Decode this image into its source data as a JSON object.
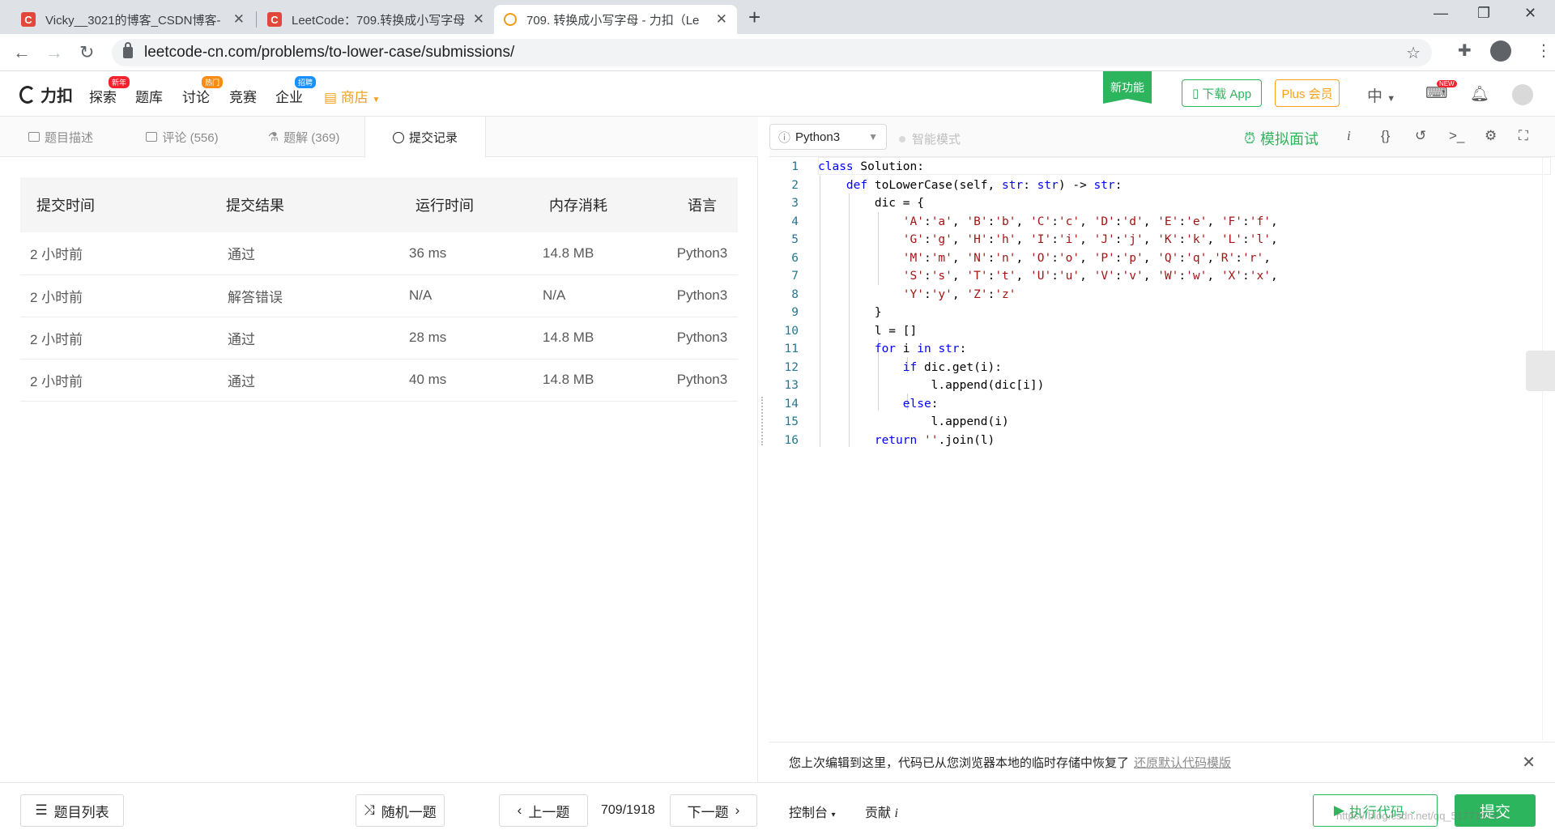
{
  "browser": {
    "tabs": [
      {
        "title": "Vicky__3021的博客_CSDN博客-",
        "favicon": "C"
      },
      {
        "title": "LeetCode：709.转换成小写字母",
        "favicon": "C"
      },
      {
        "title": "709. 转换成小写字母 - 力扣（Le",
        "favicon": "C"
      }
    ],
    "url": "leetcode-cn.com/problems/to-lower-case/submissions/"
  },
  "header": {
    "logo": "力扣",
    "nav": [
      {
        "label": "探索",
        "badge": "新年"
      },
      {
        "label": "题库",
        "badge": ""
      },
      {
        "label": "讨论",
        "badge": "热门"
      },
      {
        "label": "竞赛",
        "badge": ""
      },
      {
        "label": "企业",
        "badge": "招聘"
      },
      {
        "label": "商店",
        "badge": ""
      }
    ],
    "new_feature": "新功能",
    "download_app": "下载 App",
    "plus": "Plus 会员",
    "lang": "中",
    "new_tag": "NEW"
  },
  "left_tabs": [
    {
      "label": "题目描述"
    },
    {
      "label": "评论 (556)"
    },
    {
      "label": "题解 (369)"
    },
    {
      "label": "提交记录"
    }
  ],
  "submissions": {
    "headers": [
      "提交时间",
      "提交结果",
      "运行时间",
      "内存消耗",
      "语言"
    ],
    "rows": [
      {
        "time": "2 小时前",
        "result": "通过",
        "runtime": "36 ms",
        "memory": "14.8 MB",
        "lang": "Python3",
        "status": "accepted"
      },
      {
        "time": "2 小时前",
        "result": "解答错误",
        "runtime": "N/A",
        "memory": "N/A",
        "lang": "Python3",
        "status": "wrong"
      },
      {
        "time": "2 小时前",
        "result": "通过",
        "runtime": "28 ms",
        "memory": "14.8 MB",
        "lang": "Python3",
        "status": "accepted"
      },
      {
        "time": "2 小时前",
        "result": "通过",
        "runtime": "40 ms",
        "memory": "14.8 MB",
        "lang": "Python3",
        "status": "accepted"
      }
    ]
  },
  "editor": {
    "language": "Python3",
    "smart_mode": "智能模式",
    "mock_interview": "模拟面试",
    "code": [
      "class Solution:",
      "    def toLowerCase(self, str: str) -> str:",
      "        dic = {",
      "            'A':'a', 'B':'b', 'C':'c', 'D':'d', 'E':'e', 'F':'f',",
      "            'G':'g', 'H':'h', 'I':'i', 'J':'j', 'K':'k', 'L':'l',",
      "            'M':'m', 'N':'n', 'O':'o', 'P':'p', 'Q':'q','R':'r',",
      "            'S':'s', 'T':'t', 'U':'u', 'V':'v', 'W':'w', 'X':'x',",
      "            'Y':'y', 'Z':'z'",
      "        }",
      "        l = []",
      "        for i in str:",
      "            if dic.get(i):",
      "                l.append(dic[i])",
      "            else:",
      "                l.append(i)",
      "        return ''.join(l)"
    ]
  },
  "restore_notice": {
    "text": "您上次编辑到这里，代码已从您浏览器本地的临时存储中恢复了",
    "link": "还原默认代码模版"
  },
  "bottom": {
    "problem_list": "题目列表",
    "random": "随机一题",
    "prev": "上一题",
    "pager": "709/1918",
    "next": "下一题",
    "console": "控制台",
    "contribute": "贡献",
    "run": "执行代码",
    "submit": "提交"
  },
  "watermark": "https://blog.csdn.net/qq_51771374",
  "colors": {
    "accent_green": "#2db55d",
    "error_red": "#ef4743",
    "plus_orange": "#ffa116"
  }
}
